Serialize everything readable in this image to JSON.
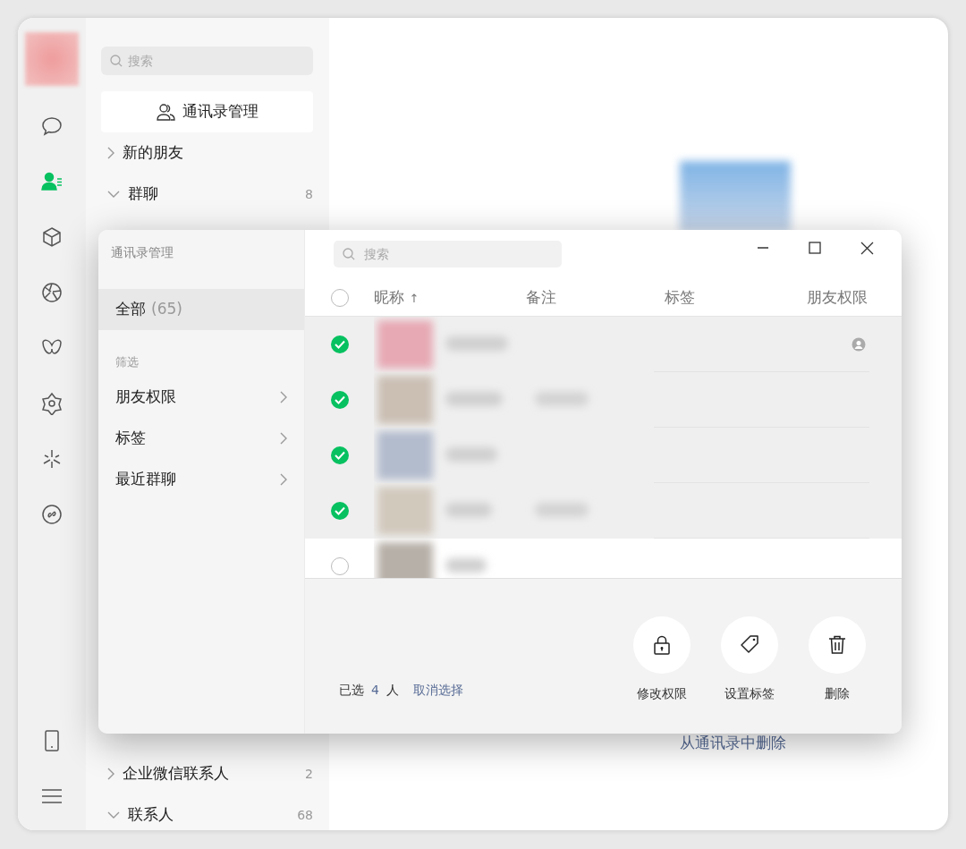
{
  "nav": [
    {
      "selected": false
    },
    {
      "selected": true
    },
    {
      "selected": false
    },
    {
      "selected": false
    },
    {
      "selected": false
    },
    {
      "selected": false
    },
    {
      "selected": false
    },
    {
      "selected": false
    }
  ],
  "contacts": {
    "search": {
      "placeholder": "搜索"
    },
    "manage_button": "通讯录管理",
    "groups": [
      {
        "label": "新的朋友",
        "expanded": false
      },
      {
        "label": "群聊",
        "count": "8",
        "expanded": true
      }
    ],
    "groups_below": [
      {
        "label": "企业微信联系人",
        "count": "2",
        "expanded": false
      },
      {
        "label": "联系人",
        "count": "68",
        "expanded": true
      }
    ]
  },
  "detail": {
    "delete_link": "从通讯录中删除"
  },
  "dialog": {
    "title": "通讯录管理",
    "all": {
      "label": "全部",
      "count": "(65)",
      "selected": true
    },
    "filter_heading": "筛选",
    "filters": [
      {
        "label": "朋友权限"
      },
      {
        "label": "标签"
      },
      {
        "label": "最近群聊"
      }
    ],
    "search": {
      "placeholder": "搜索"
    },
    "select_all": {
      "checked": false
    },
    "columns": [
      {
        "label": "昵称",
        "sort": "↑"
      },
      {
        "label": "备注"
      },
      {
        "label": "标签"
      },
      {
        "label": "朋友权限"
      }
    ],
    "rows": [
      {
        "selected": true,
        "restricted": true
      },
      {
        "selected": true,
        "restricted": false
      },
      {
        "selected": true,
        "restricted": false
      },
      {
        "selected": true,
        "restricted": false
      },
      {
        "selected": false,
        "restricted": false
      }
    ],
    "footer": {
      "prefix": "已选",
      "count": "4",
      "suffix": "人",
      "clear_link": "取消选择"
    },
    "actions": [
      {
        "kind": "lock",
        "label": "修改权限"
      },
      {
        "kind": "tag",
        "label": "设置标签"
      },
      {
        "kind": "trash",
        "label": "删除"
      }
    ]
  }
}
